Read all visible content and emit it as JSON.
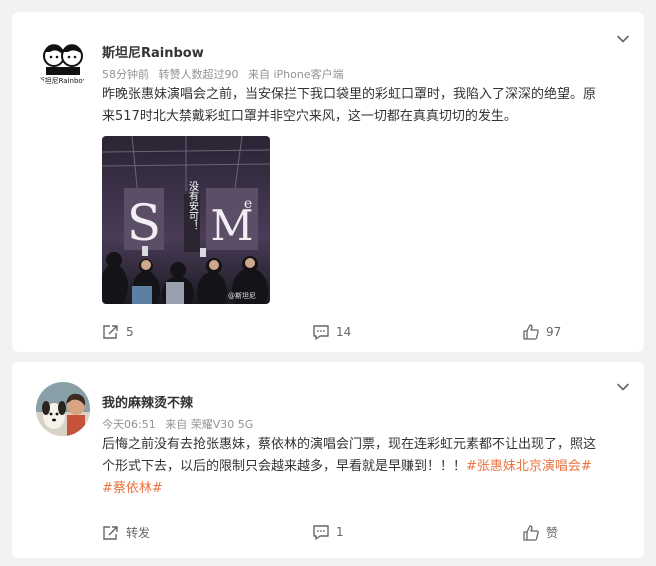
{
  "posts": [
    {
      "author": "斯坦尼Rainbow",
      "avatar_text": "斯坦尼Rainbow",
      "time": "58分钟前",
      "repost_note": "转赞人数超过90",
      "source": "来自 iPhone客户端",
      "text_line1": "昨晚张惠妹演唱会之前，当安保拦下我口袋里的彩虹口罩时，我陷入了深深的绝望。原",
      "text_line2": "来517时北大禁戴彩虹口罩并非空穴来风，这一切都在真真切切的发生。",
      "image": {
        "screen_left": "S",
        "screen_right": "M",
        "screen_right_small": "e",
        "banner": "没有安可！",
        "watermark": "@斯坦尼"
      },
      "repost_count": "5",
      "comment_count": "14",
      "like_count": "97"
    },
    {
      "author": "我的麻辣烫不辣",
      "time": "今天06:51",
      "source": "来自 荣耀V30 5G",
      "text_line1": "后悔之前没有去抢张惠妹，蔡依林的演唱会门票，现在连彩虹元素都不让出现了，照这",
      "text_line2": "个形式下去，以后的限制只会越来越多，早看就是早赚到！！！",
      "tag1": "#张惠妹北京演唱会#",
      "tag2": "#蔡依林#",
      "repost_label": "转发",
      "comment_count": "1",
      "like_label": "赞"
    }
  ],
  "colors": {
    "page_bg": "#f2f2f2",
    "card_bg": "#ffffff",
    "tag": "#eb7340",
    "meta": "#939393"
  },
  "icons": [
    "chevron-down-icon",
    "repost-icon",
    "comment-icon",
    "like-icon"
  ]
}
